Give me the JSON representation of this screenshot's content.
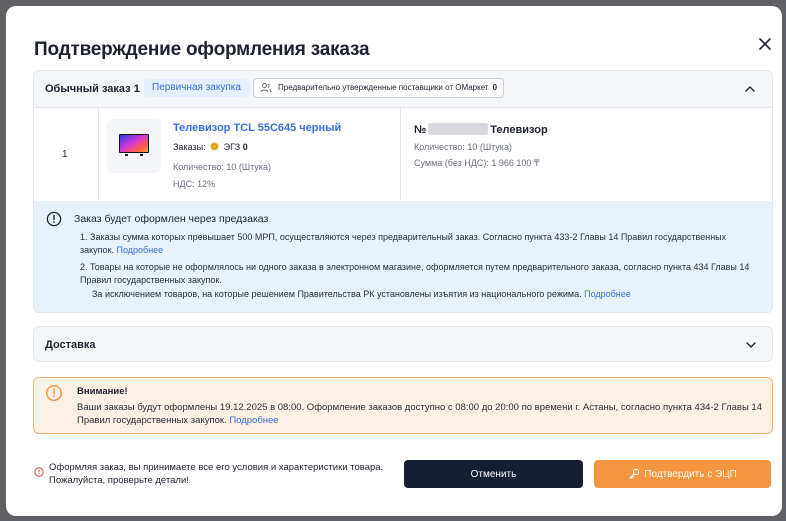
{
  "modal": {
    "title": "Подтверждение оформления заказа"
  },
  "order": {
    "title": "Обычный заказ 1",
    "badge_primary": "Первичная закупка",
    "badge_suppliers": "Предварительно утвержденные поставщики от ОМаркет",
    "badge_suppliers_count": "0",
    "row_number": "1",
    "product": {
      "name": "Телевизор TCL 55C645 черный",
      "orders_label": "Заказы:",
      "orders_type": "ЭГЗ",
      "orders_count": "0",
      "quantity": "Количество: 10 (Штука)",
      "vat": "НДС: 12%"
    },
    "lot": {
      "prefix": "№",
      "suffix": "Телевизор",
      "quantity": "Количество: 10 (Штука)",
      "sum": "Сумма (без НДС): 1 966 100 ₸"
    }
  },
  "info": {
    "title": "Заказ будет оформлен через предзаказ",
    "p1": "1. Заказы сумма которых превышает 500 МРП, осуществляются через предварительный заказ. Согласно пункта 433-2 Главы 14 Правил государственных закупок.",
    "p1_link": "Подробнее",
    "p2": "2. Товары на которые не оформлялось ни одного заказа в электронном магазине, оформляется путем предварительного заказа, согласно пункта 434 Главы 14 Правил государственных закупок.",
    "p3": "За исключением товаров, на которые решением Правительства РК установлены изъятия из национального режима.",
    "p3_link": "Подробнее"
  },
  "delivery": {
    "label": "Доставка"
  },
  "warning": {
    "title": "Внимание!",
    "text": "Ваши заказы будут оформлены 19.12.2025 в 08:00. Оформление заказов доступно с 08:00 до 20:00 по времени г. Астаны, согласно пункта 434-2 Главы 14 Правил государственных закупок.",
    "link": "Подробнее"
  },
  "footer": {
    "notice": "Оформляя заказ, вы принимаете все его условия и характеристики товара. Пожалуйста, проверьте детали!",
    "cancel_label": "Отменить",
    "confirm_label": "Подтвердить с ЭЦП"
  },
  "colors": {
    "accent": "#3a6fd8",
    "primary_dark": "#161e33",
    "confirm_orange": "#f6953f",
    "info_bg": "#e8f2fc",
    "warning_bg": "#fdf0e4",
    "warning_border": "#f0b27a",
    "error_red": "#e0444e"
  },
  "icons": [
    "close-icon",
    "chevron-up-icon",
    "users-icon",
    "coin-icon",
    "info-icon",
    "chevron-down-icon",
    "warning-icon",
    "alert-icon",
    "key-icon"
  ]
}
